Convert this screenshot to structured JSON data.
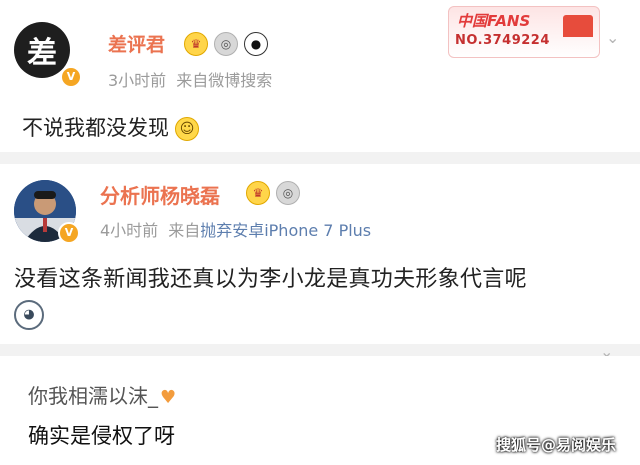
{
  "posts": [
    {
      "avatar_char": "差",
      "verified_mark": "V",
      "username": "差评君",
      "badges": [
        "crown-icon",
        "medal-icon",
        "panda-icon"
      ],
      "time": "3小时前",
      "source": "来自微博搜索",
      "content": "不说我都没发现",
      "fans_badge": {
        "title": "中国FANS",
        "number": "NO.3749224"
      }
    },
    {
      "verified_mark": "V",
      "username": "分析师杨晓磊",
      "badges": [
        "crown-icon",
        "medal-icon"
      ],
      "time": "4小时前",
      "source_prefix": "来自",
      "device": "抛弃安卓iPhone 7 Plus",
      "content": "没看这条新闻我还真以为李小龙是真功夫形象代言呢"
    }
  ],
  "comments": [
    {
      "text": "你我相濡以沫_"
    },
    {
      "text": "确实是侵权了呀"
    }
  ],
  "watermark": "搜狐号@易阅娱乐",
  "colors": {
    "username": "#eb7350",
    "meta": "#9b9b9b",
    "device_link": "#5d7eae",
    "verified": "#f5a623"
  }
}
